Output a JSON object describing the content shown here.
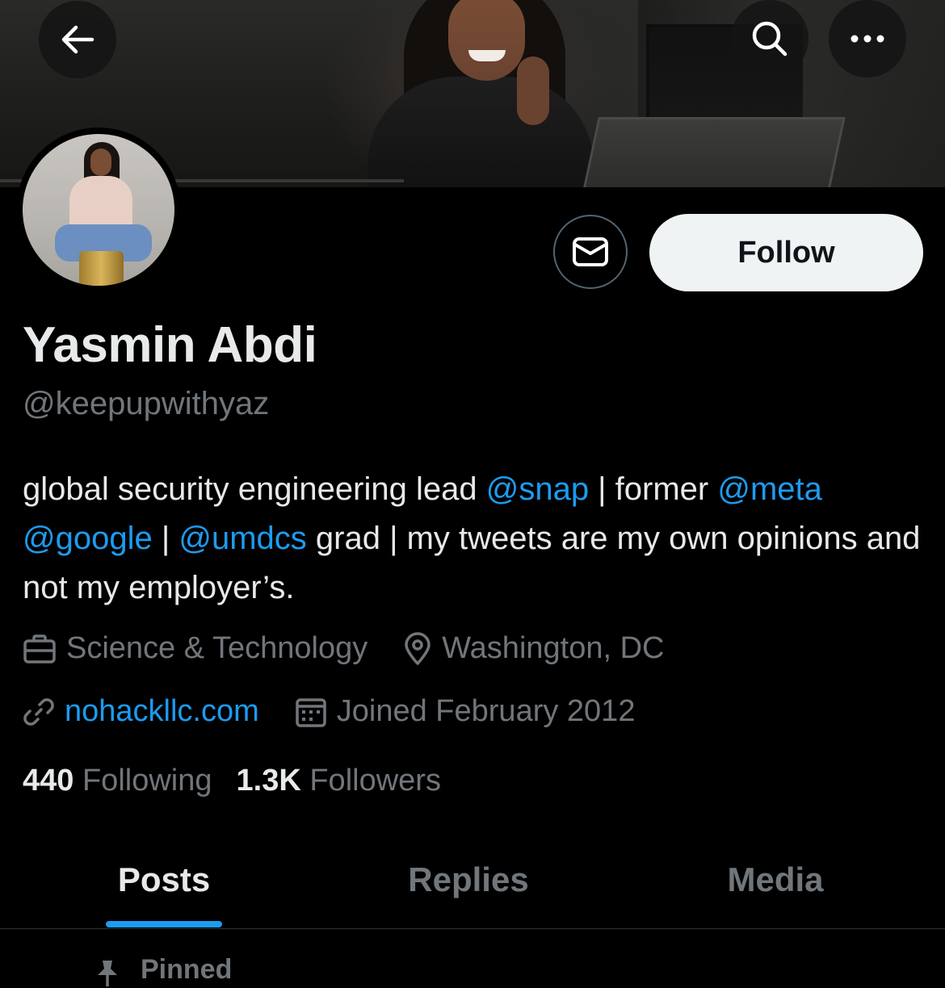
{
  "header": {
    "icons": {
      "back": "arrow-left-icon",
      "search": "search-icon",
      "more": "more-horizontal-icon"
    }
  },
  "profile": {
    "display_name": "Yasmin Abdi",
    "handle": "@keepupwithyaz",
    "follow_label": "Follow",
    "bio": {
      "t1": "global security engineering lead ",
      "m1": "@snap",
      "t2": " | former ",
      "m2": "@meta",
      "m3": "@google",
      "t3": " | ",
      "m4": "@umdcs",
      "t4": " grad | my tweets are my own opinions and not my employer’s."
    },
    "category": "Science & Technology",
    "location": "Washington, DC",
    "website": "nohackllc.com",
    "joined": "Joined February 2012",
    "following_count": "440",
    "following_label": "Following",
    "followers_count": "1.3K",
    "followers_label": "Followers"
  },
  "tabs": [
    {
      "label": "Posts",
      "active": true
    },
    {
      "label": "Replies",
      "active": false
    },
    {
      "label": "Media",
      "active": false
    }
  ],
  "timeline": {
    "pinned_label": "Pinned"
  },
  "colors": {
    "background": "#000000",
    "accent": "#1d9bf0",
    "secondary_text": "#71767b",
    "primary_text": "#e7e9ea",
    "follow_button_bg": "#eff3f4"
  }
}
